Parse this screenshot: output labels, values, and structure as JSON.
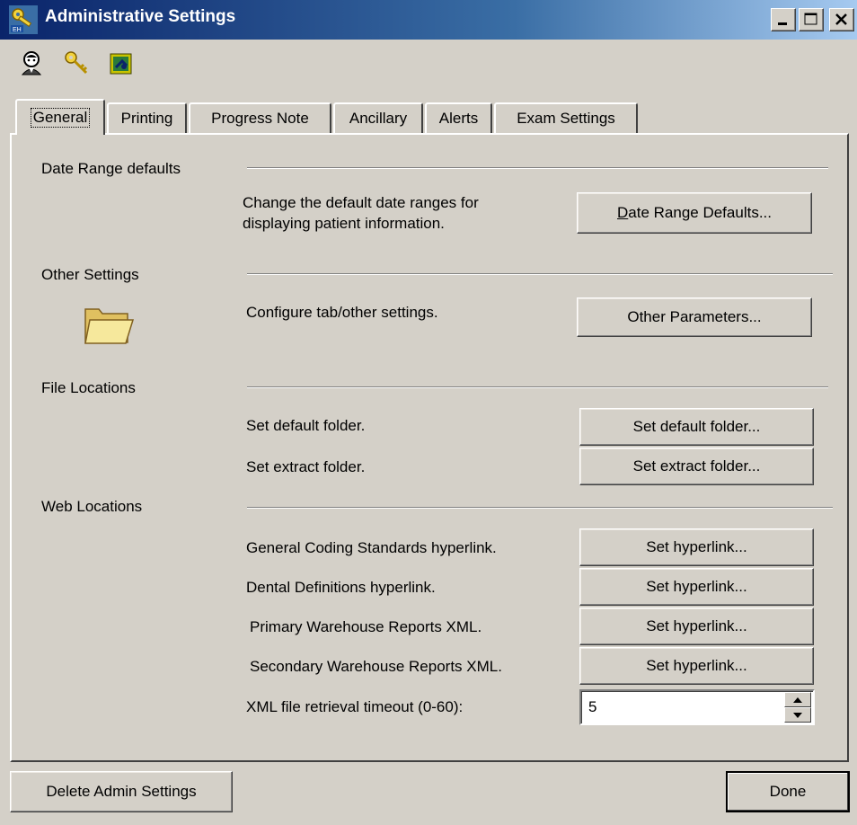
{
  "window": {
    "title": "Administrative Settings",
    "controls": {
      "minimize": "_",
      "maximize": "□",
      "close": "X"
    }
  },
  "toolbar": {
    "icons": [
      "user-icon",
      "key-icon",
      "settings-icon"
    ]
  },
  "tabs": [
    {
      "label": "General",
      "active": true
    },
    {
      "label": "Printing"
    },
    {
      "label": "Progress Note"
    },
    {
      "label": "Ancillary"
    },
    {
      "label": "Alerts"
    },
    {
      "label": "Exam Settings"
    }
  ],
  "sections": {
    "date_range": {
      "title": "Date Range defaults",
      "desc_line1": "Change the default date ranges for",
      "desc_line2": "displaying patient information.",
      "button_prefix": "D",
      "button_rest": "ate Range Defaults..."
    },
    "other": {
      "title": "Other Settings",
      "icon": "folder-icon",
      "desc": "Configure tab/other settings.",
      "button": "Other Parameters..."
    },
    "file_locations": {
      "title": "File Locations",
      "rows": [
        {
          "desc": "Set default folder.",
          "button": "Set default folder..."
        },
        {
          "desc": "Set extract folder.",
          "button": "Set extract folder..."
        }
      ]
    },
    "web_locations": {
      "title": "Web Locations",
      "rows": [
        {
          "desc": "General Coding Standards hyperlink.",
          "button": "Set hyperlink..."
        },
        {
          "desc": "Dental Definitions hyperlink.",
          "button": "Set hyperlink..."
        },
        {
          "desc": "Primary Warehouse Reports XML.",
          "button": "Set hyperlink..."
        },
        {
          "desc": "Secondary Warehouse Reports XML.",
          "button": "Set hyperlink..."
        }
      ],
      "timeout_label": "XML file retrieval timeout (0-60):",
      "timeout_value": "5"
    }
  },
  "footer": {
    "delete_button": "Delete Admin Settings",
    "done_button": "Done"
  }
}
